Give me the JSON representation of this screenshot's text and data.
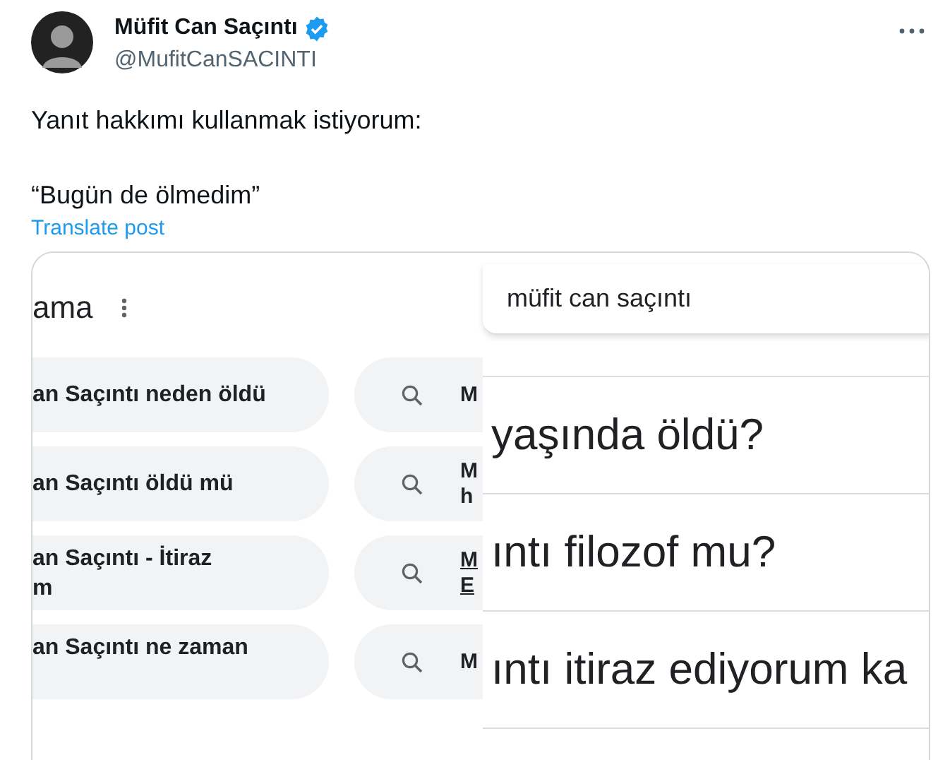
{
  "author": {
    "name": "Müfit Can Saçıntı",
    "verified": true,
    "handle": "@MufitCanSACINTI"
  },
  "post": {
    "paragraphs": [
      "Yanıt hakkımı kullanmak istiyorum:",
      "“Bugün de ölmedim”"
    ],
    "translate_link": "Translate post"
  },
  "media": {
    "left_panel": {
      "title": "ama",
      "suggestions": [
        {
          "lines": [
            "an Saçıntı neden öldü"
          ]
        },
        {
          "lines": [
            "an Saçıntı öldü mü"
          ]
        },
        {
          "lines": [
            "an Saçıntı - İtiraz",
            "m"
          ]
        },
        {
          "lines": [
            "an Saçıntı ne zaman"
          ]
        }
      ],
      "side_results": [
        {
          "lines": [
            "M"
          ],
          "underlined": false
        },
        {
          "lines": [
            "M",
            "h"
          ],
          "underlined": false
        },
        {
          "lines": [
            "M",
            "E"
          ],
          "underlined": true
        },
        {
          "lines": [
            "M"
          ],
          "underlined": false
        }
      ]
    },
    "right_panel": {
      "search_value": "müfit can saçıntı",
      "questions": [
        "yaşında öldü?",
        "ıntı filozof mu?",
        "ıntı itiraz ediyorum ka"
      ]
    }
  }
}
